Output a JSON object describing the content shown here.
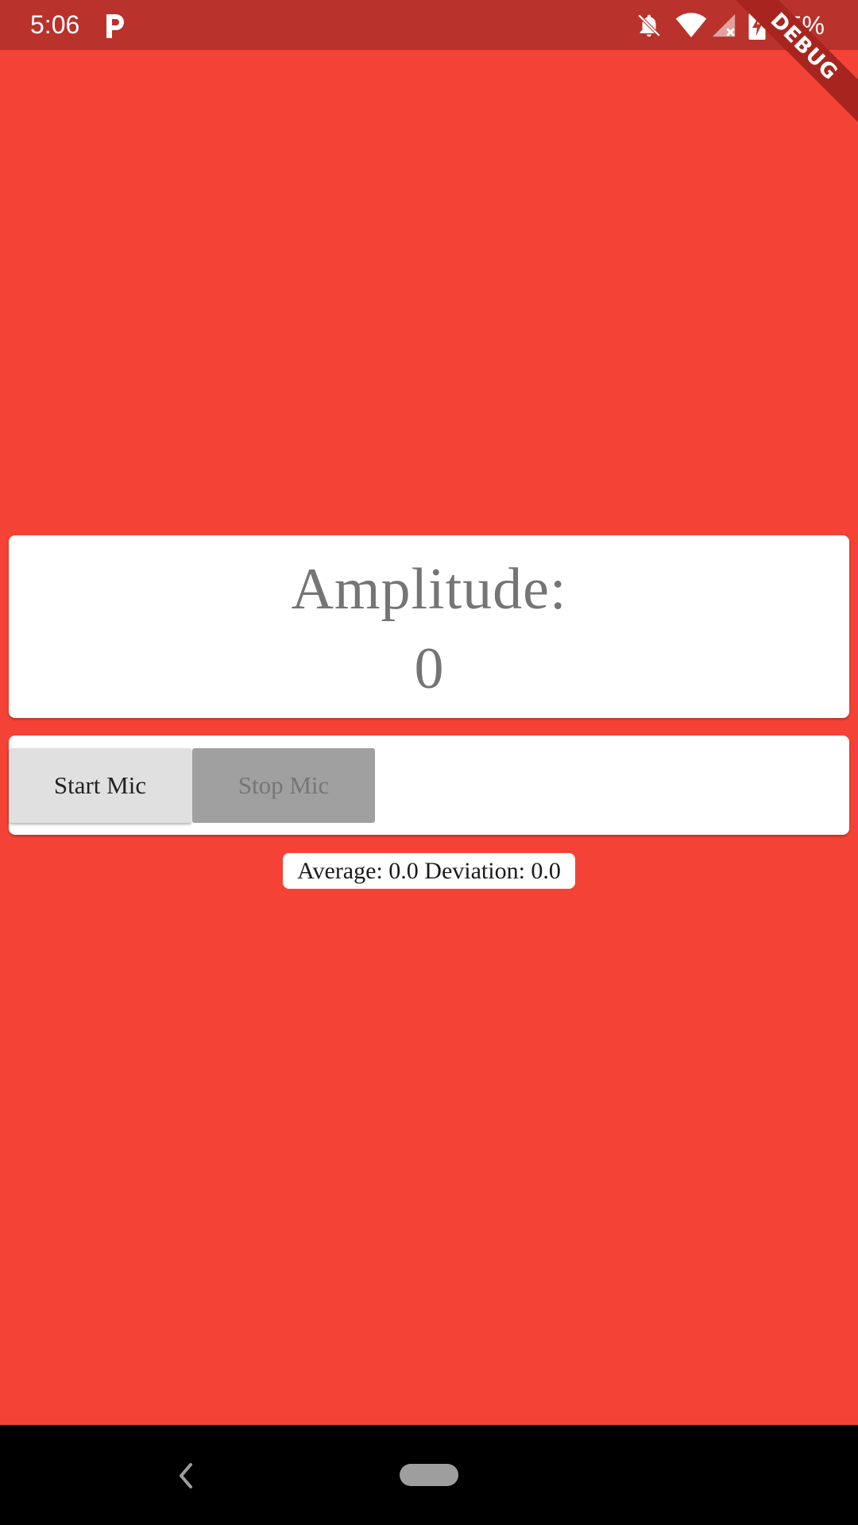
{
  "status_bar": {
    "time": "5:06",
    "battery": "95%",
    "icons": [
      "p-app-icon",
      "bell-off-icon",
      "wifi-icon",
      "signal-no-data-icon",
      "battery-charging-icon"
    ]
  },
  "debug_banner": {
    "label": "DEBUG"
  },
  "amplitude": {
    "title": "Amplitude:",
    "value": "0"
  },
  "controls": {
    "start_label": "Start Mic",
    "stop_label": "Stop Mic",
    "stop_enabled": false
  },
  "stats": {
    "text": "Average: 0.0 Deviation: 0.0"
  },
  "colors": {
    "background": "#f44336",
    "status_bar": "#b9322b",
    "card": "#ffffff",
    "start_button": "#e0e0e0",
    "stop_button_disabled": "#a0a0a0"
  },
  "nav_bar": {
    "icons": [
      "back-icon",
      "home-pill-icon"
    ]
  }
}
